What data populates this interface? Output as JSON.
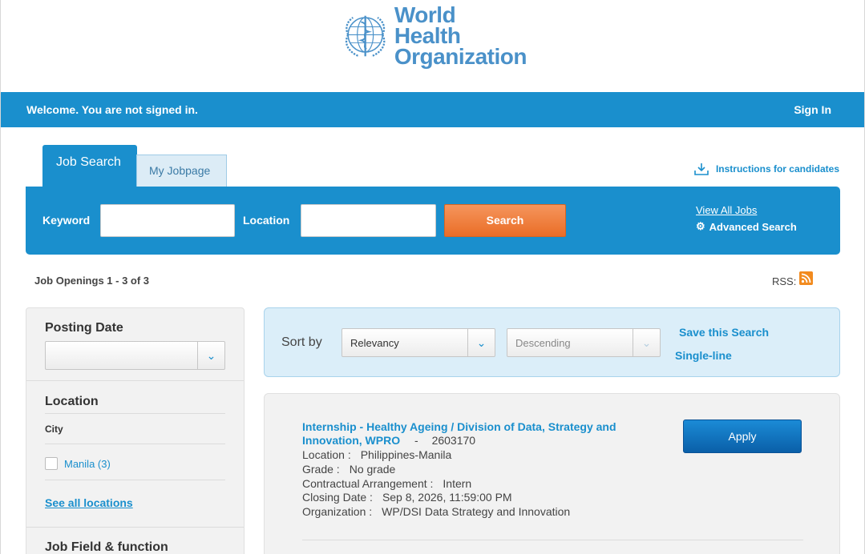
{
  "header": {
    "logo_line1": "World Health",
    "logo_line2": "Organization"
  },
  "welcome_bar": {
    "message": "Welcome. You are not signed in.",
    "sign_in": "Sign In"
  },
  "tabs": [
    {
      "label": "Job Search",
      "active": true
    },
    {
      "label": "My Jobpage",
      "active": false
    }
  ],
  "instructions_link": "Instructions for candidates",
  "search": {
    "keyword_label": "Keyword",
    "keyword_value": "",
    "location_label": "Location",
    "location_value": "",
    "search_button": "Search",
    "view_all_jobs": "View All Jobs",
    "advanced_search": "Advanced Search"
  },
  "results": {
    "openings_text": "Job Openings 1 - 3 of 3",
    "rss_label": "RSS:"
  },
  "sidebar": {
    "posting_date_title": "Posting Date",
    "posting_date_value": "",
    "location_title": "Location",
    "city_label": "City",
    "city_options": [
      {
        "label": "Manila (3)",
        "checked": false
      }
    ],
    "see_all_locations": "See all locations",
    "job_field_title": "Job Field & function"
  },
  "sort": {
    "label": "Sort by",
    "sort_field": "Relevancy",
    "sort_order": "Descending",
    "save_search": "Save this Search",
    "single_line": "Single-line"
  },
  "jobs": [
    {
      "title": "Internship - Healthy Ageing / Division of Data, Strategy and Innovation, WPRO",
      "separator": "-",
      "id": "2603170",
      "apply_label": "Apply",
      "fields": [
        {
          "key": "Location :",
          "value": "Philippines-Manila"
        },
        {
          "key": "Grade :",
          "value": "No grade"
        },
        {
          "key": "Contractual Arrangement :",
          "value": "Intern"
        },
        {
          "key": "Closing Date :",
          "value": "Sep 8, 2026, 11:59:00 PM"
        },
        {
          "key": "Organization :",
          "value": "WP/DSI Data Strategy and Innovation"
        }
      ]
    }
  ],
  "colors": {
    "primary": "#1a8fcd",
    "search_button": "#ea6d27",
    "apply_button": "#0a5fa8",
    "logo": "#4a91c9",
    "rss": "#f28b1f"
  }
}
